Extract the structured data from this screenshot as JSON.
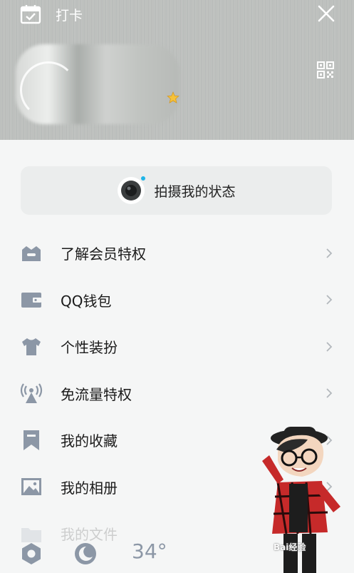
{
  "header": {
    "checkin_label": "打卡"
  },
  "status_button": {
    "label": "拍摄我的状态"
  },
  "menu": {
    "items": [
      {
        "label": "了解会员特权",
        "icon": "crown-icon"
      },
      {
        "label": "QQ钱包",
        "icon": "wallet-icon"
      },
      {
        "label": "个性装扮",
        "icon": "shirt-icon"
      },
      {
        "label": "免流量特权",
        "icon": "signal-tower-icon"
      },
      {
        "label": "我的收藏",
        "icon": "bookmark-icon"
      },
      {
        "label": "我的相册",
        "icon": "photo-icon"
      },
      {
        "label": "我的文件",
        "icon": "folder-icon"
      }
    ]
  },
  "bottom": {
    "temperature": "34°"
  },
  "watermark": "Bai经验",
  "colors": {
    "icon_gray": "#8c97a6",
    "status_bg": "#ebeded",
    "accent_dot": "#1fb5e8"
  }
}
